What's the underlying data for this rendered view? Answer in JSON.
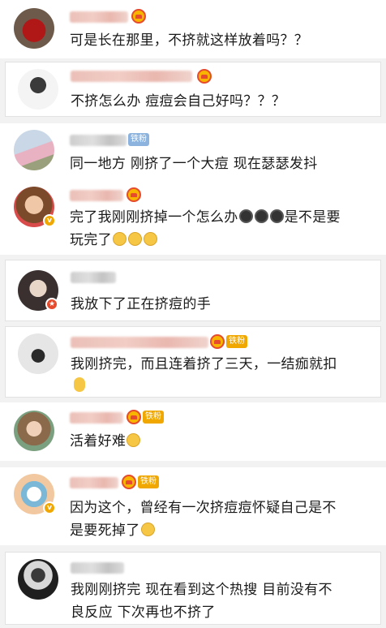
{
  "comments": [
    {
      "text": "可是长在那里，不挤就这样放着吗？？"
    },
    {
      "text": "不挤怎么办 痘痘会自己好吗？？？"
    },
    {
      "text": "同一地方 刚挤了一个大痘 现在瑟瑟发抖",
      "tag": "铁粉"
    },
    {
      "text_line1": "完了我刚刚挤掉一个怎么办",
      "text_line1b": "是不是要",
      "text_line2": "玩完了"
    },
    {
      "text": "我放下了正在挤痘的手"
    },
    {
      "text_line1": "我刚挤完，而且连着挤了三天，一结痂就扣",
      "tag": "铁粉"
    },
    {
      "text": "活着好难",
      "tag": "铁粉"
    },
    {
      "text_line1": "因为这个，曾经有一次挤痘痘怀疑自己是不",
      "text_line2": "是要死掉了",
      "tag": "铁粉"
    },
    {
      "text_line1": "我刚刚挤完 现在看到这个热搜 目前没有不",
      "text_line2": "良反应 下次再也不挤了"
    }
  ],
  "colors": {
    "vip": "#f7b500",
    "fan_tag": "#f0a800",
    "fan_tag_blue": "#8bb3dd"
  }
}
